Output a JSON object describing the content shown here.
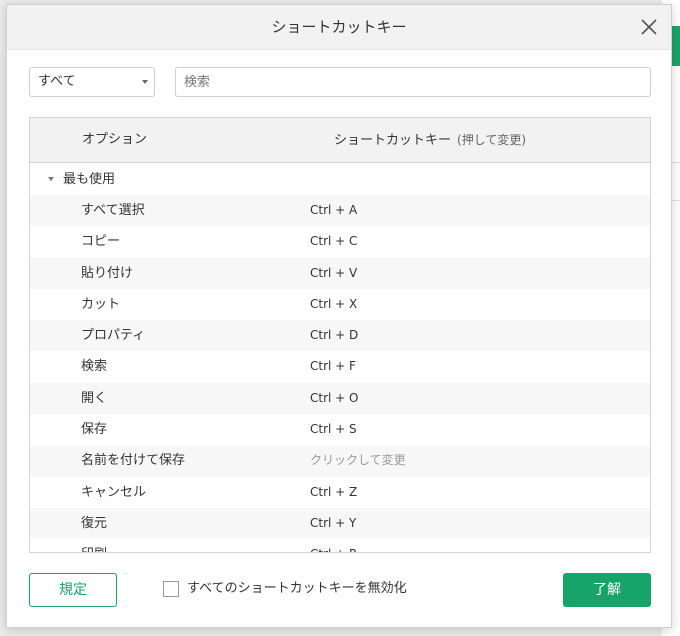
{
  "dialog": {
    "title": "ショートカットキー"
  },
  "filter": {
    "selected": "すべて"
  },
  "search": {
    "placeholder": "検索"
  },
  "table": {
    "col_option": "オプション",
    "col_shortcut": "ショートカットキー",
    "col_shortcut_hint": "(押して変更)",
    "group": "最も使用",
    "rows": [
      {
        "option": "すべて選択",
        "shortcut": "Ctrl + A"
      },
      {
        "option": "コピー",
        "shortcut": "Ctrl + C"
      },
      {
        "option": "貼り付け",
        "shortcut": "Ctrl + V"
      },
      {
        "option": "カット",
        "shortcut": "Ctrl + X"
      },
      {
        "option": "プロパティ",
        "shortcut": "Ctrl + D"
      },
      {
        "option": "検索",
        "shortcut": "Ctrl + F"
      },
      {
        "option": "開く",
        "shortcut": "Ctrl + O"
      },
      {
        "option": "保存",
        "shortcut": "Ctrl + S"
      },
      {
        "option": "名前を付けて保存",
        "shortcut": "クリックして変更"
      },
      {
        "option": "キャンセル",
        "shortcut": "Ctrl + Z"
      },
      {
        "option": "復元",
        "shortcut": "Ctrl + Y"
      },
      {
        "option": "印刷",
        "shortcut": "Ctrl + P"
      }
    ]
  },
  "footer": {
    "default_label": "規定",
    "disable_all_label": "すべてのショートカットキーを無効化",
    "ok_label": "了解"
  },
  "colors": {
    "accent": "#17a46b"
  },
  "icons": {
    "close": "close-icon",
    "dropdown": "chevron-down-icon",
    "group_toggle": "caret-down-icon"
  }
}
